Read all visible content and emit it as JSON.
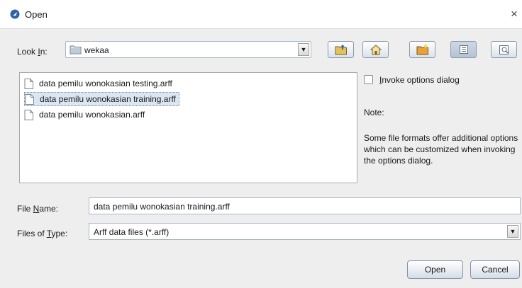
{
  "window": {
    "title": "Open",
    "close_glyph": "×"
  },
  "look_in": {
    "label_pre": "Look ",
    "label_mnemonic": "I",
    "label_post": "n:",
    "value": "wekaa"
  },
  "toolbar": {
    "buttons": [
      "up-one-level",
      "home",
      "create-new-folder",
      "list-view",
      "details-view"
    ]
  },
  "files": [
    {
      "name": "data pemilu wonokasian testing.arff",
      "selected": false
    },
    {
      "name": "data pemilu wonokasian training.arff",
      "selected": true
    },
    {
      "name": "data pemilu wonokasian.arff",
      "selected": false
    }
  ],
  "options": {
    "checkbox_mnemonic": "I",
    "checkbox_rest": "nvoke options dialog",
    "checked": false,
    "note_title": "Note:",
    "note_body": "Some file formats offer additional options which can be customized when invoking the options dialog."
  },
  "file_name": {
    "label_pre": "File ",
    "label_mnemonic": "N",
    "label_post": "ame:",
    "value": "data pemilu wonokasian training.arff"
  },
  "file_type": {
    "label_pre": "Files of ",
    "label_mnemonic": "T",
    "label_post": "ype:",
    "value": "Arff data files (*.arff)"
  },
  "buttons": {
    "open": "Open",
    "cancel": "Cancel"
  },
  "colors": {
    "accent": "#2f63a8",
    "selection": "#dbe6f3",
    "background": "#eeeeee"
  }
}
